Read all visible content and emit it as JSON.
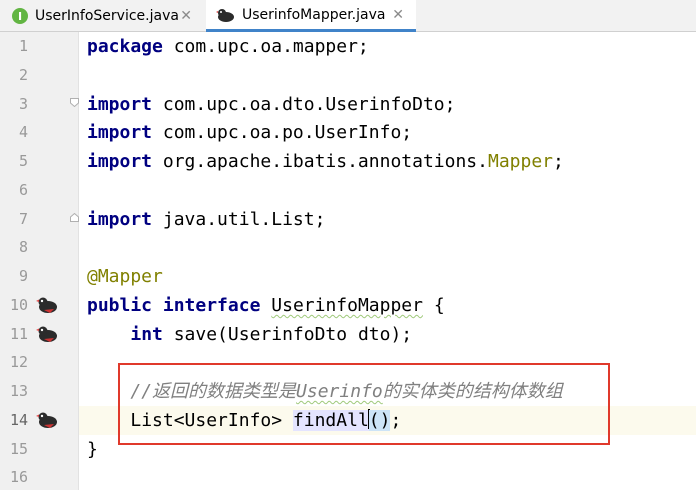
{
  "tabs": [
    {
      "label": "UserInfoService.java",
      "icon": "interface-i-icon",
      "active": false
    },
    {
      "label": "UserinfoMapper.java",
      "icon": "mybatis-bird-icon",
      "active": true
    }
  ],
  "close_glyph": "✕",
  "interface_badge": "I",
  "line_numbers": [
    "1",
    "2",
    "3",
    "4",
    "5",
    "6",
    "7",
    "8",
    "9",
    "10",
    "11",
    "12",
    "13",
    "14",
    "15",
    "16"
  ],
  "code": {
    "l1_kw": "package",
    "l1_rest": " com.upc.oa.mapper;",
    "l3_kw": "import",
    "l3_rest": " com.upc.oa.dto.UserinfoDto;",
    "l4_kw": "import",
    "l4_rest": " com.upc.oa.po.UserInfo;",
    "l5_kw": "import",
    "l5_rest": " org.apache.ibatis.annotations.",
    "l5_ann": "Mapper",
    "l5_end": ";",
    "l7_kw": "import",
    "l7_rest": " java.util.List;",
    "l9_ann": "@Mapper",
    "l10_kw1": "public",
    "l10_kw2": "interface",
    "l10_name": "UserinfoMapper",
    "l10_end": " {",
    "l11_kw": "int",
    "l11_rest": " save(UserinfoDto dto);",
    "l13_comment_a": "//返回的数据类型是",
    "l13_comment_b": "Userinfo",
    "l13_comment_c": "的实体类的结构体数组",
    "l14_a": "List<UserInfo> ",
    "l14_method": "findAll",
    "l14_paren": "()",
    "l14_end": ";",
    "l15": "}"
  },
  "colors": {
    "keyword": "#000080",
    "annotation": "#808000",
    "comment": "#808080",
    "highlight_box": "#e0392b",
    "caret_line": "#fcfaed"
  }
}
